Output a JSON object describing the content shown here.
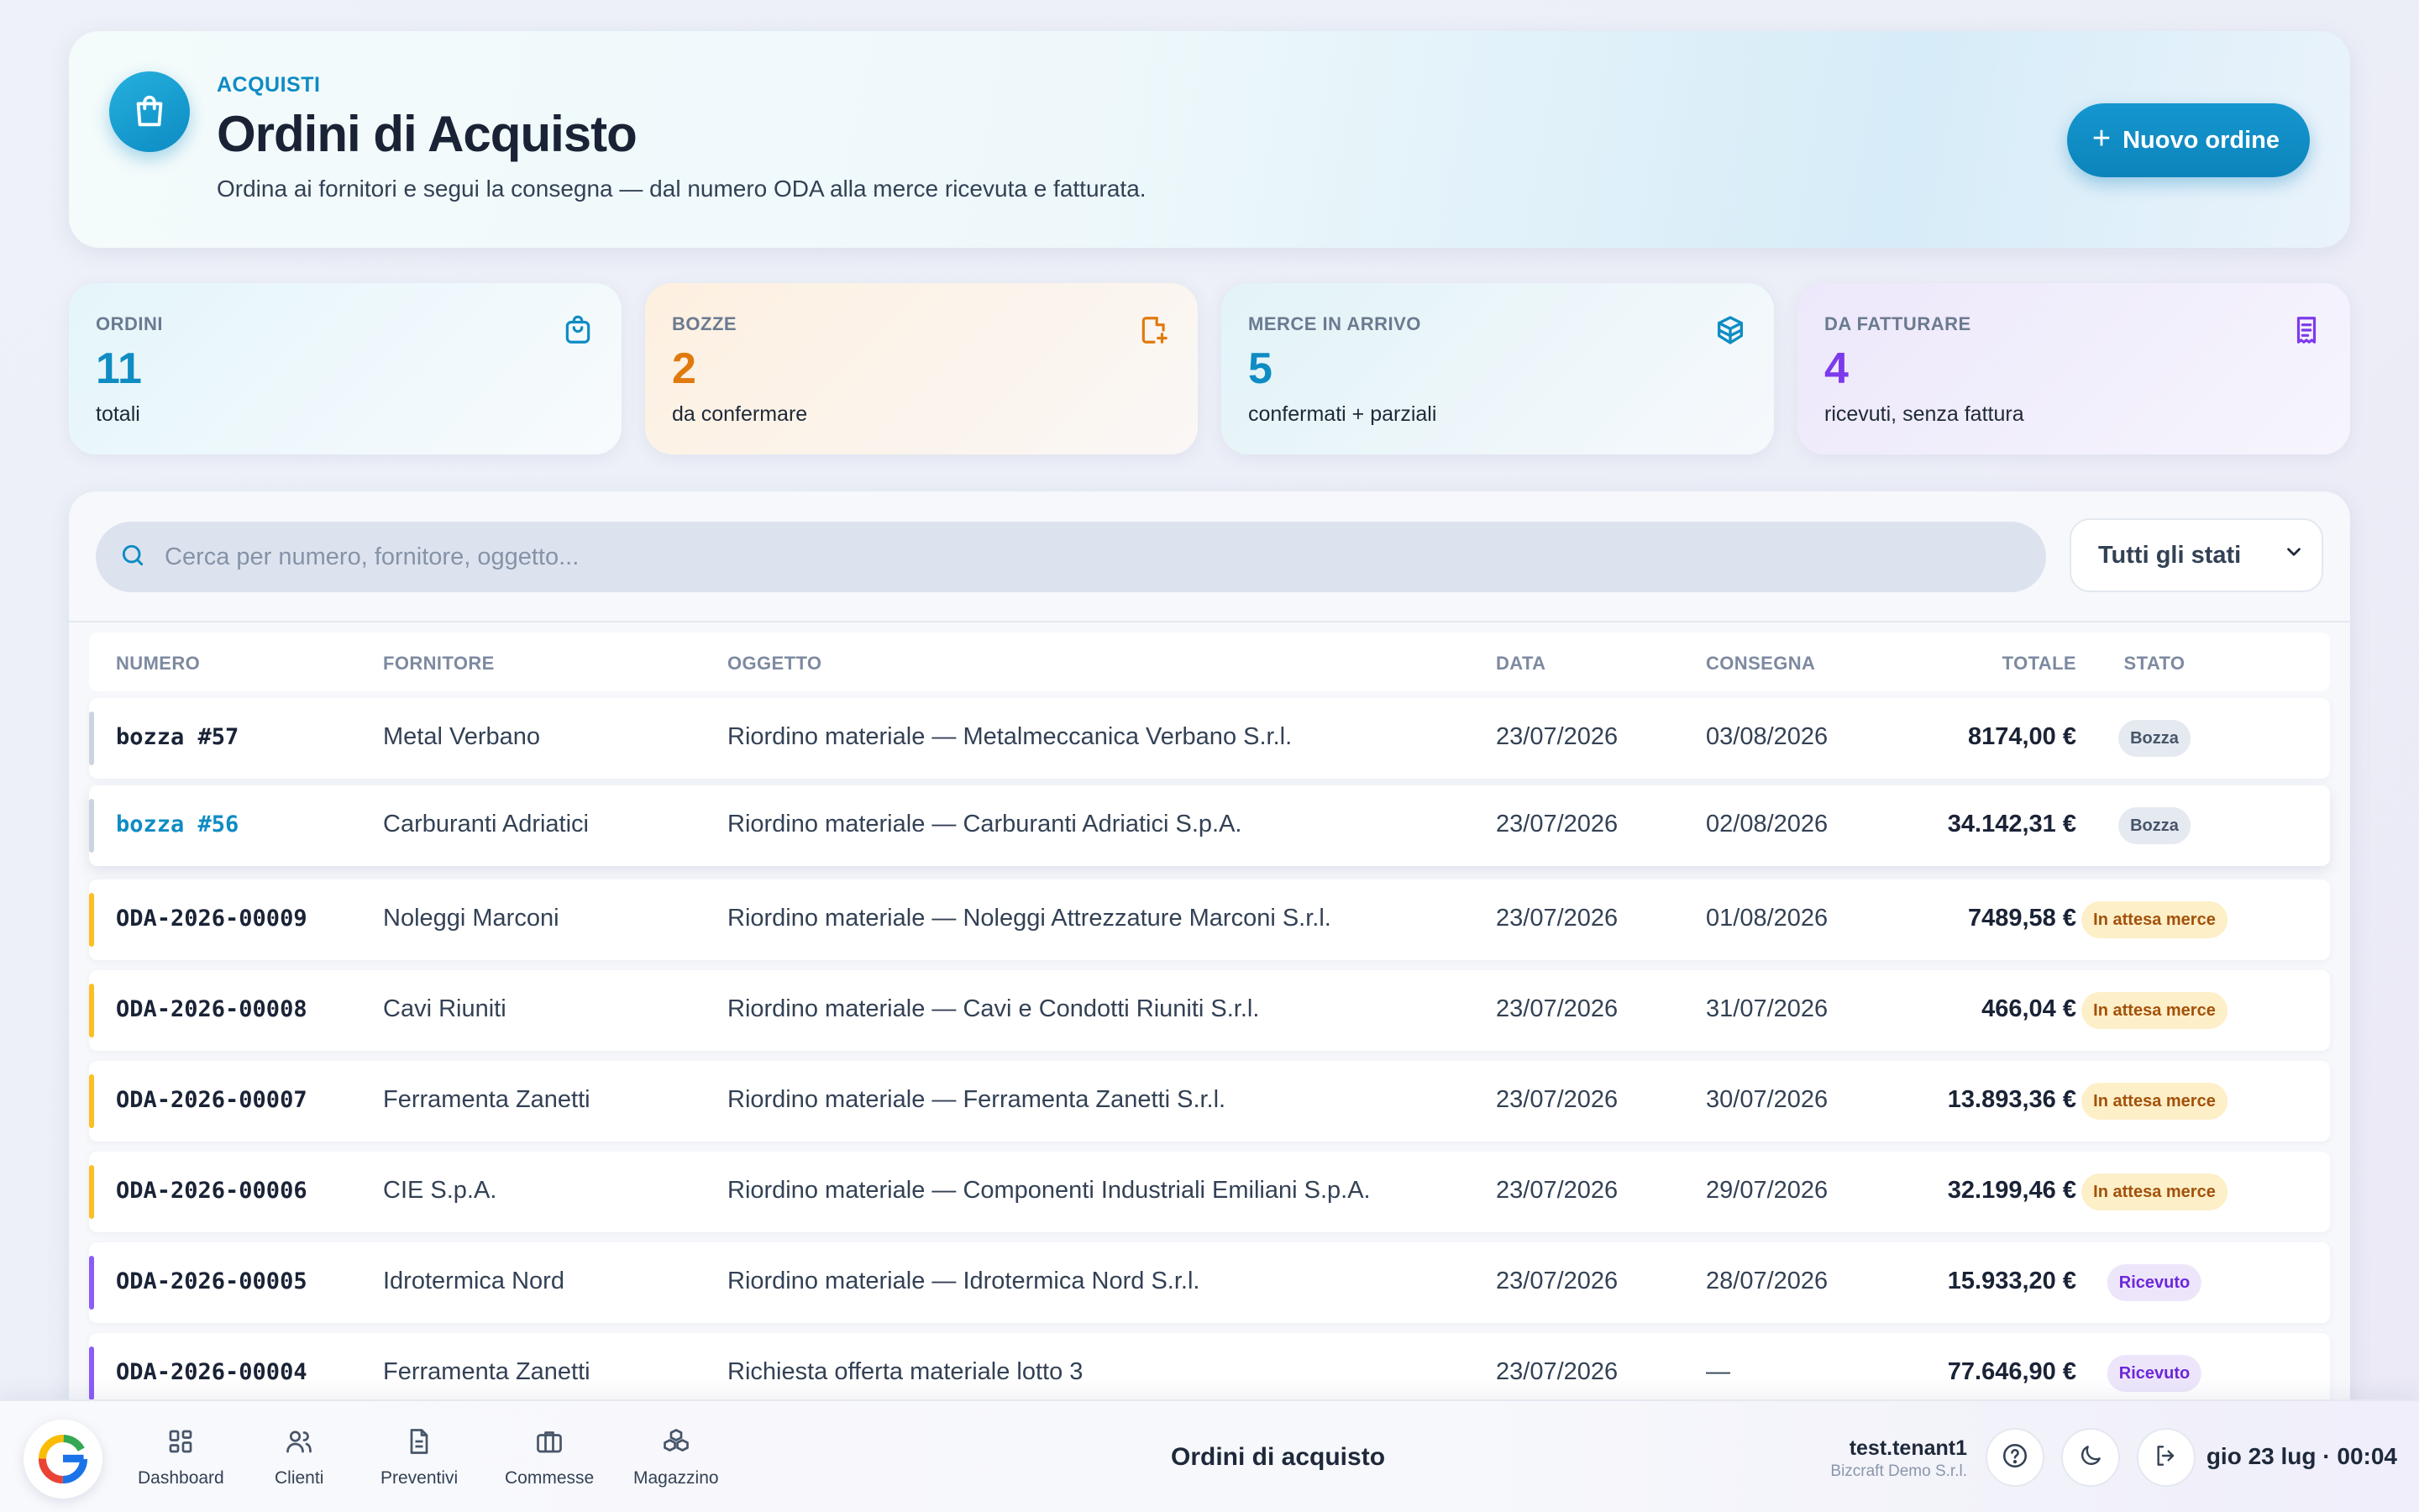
{
  "header": {
    "eyebrow": "ACQUISTI",
    "title": "Ordini di Acquisto",
    "subtitle": "Ordina ai fornitori e segui la consegna — dal numero ODA alla merce ricevuta e fatturata.",
    "new_button": "Nuovo ordine",
    "icon": "shopping-bag-icon"
  },
  "stats": [
    {
      "label": "ORDINI",
      "value": "11",
      "desc": "totali",
      "icon": "shopping-bag-icon",
      "color": "#0e8cc3"
    },
    {
      "label": "BOZZE",
      "value": "2",
      "desc": "da confermare",
      "icon": "file-plus-icon",
      "color": "#e07a0c"
    },
    {
      "label": "MERCE IN ARRIVO",
      "value": "5",
      "desc": "confermati + parziali",
      "icon": "package-icon",
      "color": "#0e8cc3"
    },
    {
      "label": "DA FATTURARE",
      "value": "4",
      "desc": "ricevuti, senza fattura",
      "icon": "receipt-icon",
      "color": "#7c3aed"
    }
  ],
  "filters": {
    "search_placeholder": "Cerca per numero, fornitore, oggetto...",
    "status_select": "Tutti gli stati"
  },
  "table": {
    "columns": [
      "NUMERO",
      "FORNITORE",
      "OGGETTO",
      "DATA",
      "CONSEGNA",
      "TOTALE",
      "STATO"
    ],
    "rows": [
      {
        "numero": "bozza #57",
        "fornitore": "Metal Verbano",
        "oggetto": "Riordino materiale — Metalmeccanica Verbano S.r.l.",
        "data": "23/07/2026",
        "consegna": "03/08/2026",
        "totale": "8174,00 €",
        "stato": "Bozza",
        "kind": "bozza"
      },
      {
        "numero": "bozza #56",
        "fornitore": "Carburanti Adriatici",
        "oggetto": "Riordino materiale — Carburanti Adriatici S.p.A.",
        "data": "23/07/2026",
        "consegna": "02/08/2026",
        "totale": "34.142,31 €",
        "stato": "Bozza",
        "kind": "bozza"
      },
      {
        "numero": "ODA-2026-00009",
        "fornitore": "Noleggi Marconi",
        "oggetto": "Riordino materiale — Noleggi Attrezzature Marconi S.r.l.",
        "data": "23/07/2026",
        "consegna": "01/08/2026",
        "totale": "7489,58 €",
        "stato": "In attesa merce",
        "kind": "attesa"
      },
      {
        "numero": "ODA-2026-00008",
        "fornitore": "Cavi Riuniti",
        "oggetto": "Riordino materiale — Cavi e Condotti Riuniti S.r.l.",
        "data": "23/07/2026",
        "consegna": "31/07/2026",
        "totale": "466,04 €",
        "stato": "In attesa merce",
        "kind": "attesa"
      },
      {
        "numero": "ODA-2026-00007",
        "fornitore": "Ferramenta Zanetti",
        "oggetto": "Riordino materiale — Ferramenta Zanetti S.r.l.",
        "data": "23/07/2026",
        "consegna": "30/07/2026",
        "totale": "13.893,36 €",
        "stato": "In attesa merce",
        "kind": "attesa"
      },
      {
        "numero": "ODA-2026-00006",
        "fornitore": "CIE S.p.A.",
        "oggetto": "Riordino materiale — Componenti Industriali Emiliani S.p.A.",
        "data": "23/07/2026",
        "consegna": "29/07/2026",
        "totale": "32.199,46 €",
        "stato": "In attesa merce",
        "kind": "attesa"
      },
      {
        "numero": "ODA-2026-00005",
        "fornitore": "Idrotermica Nord",
        "oggetto": "Riordino materiale — Idrotermica Nord S.r.l.",
        "data": "23/07/2026",
        "consegna": "28/07/2026",
        "totale": "15.933,20 €",
        "stato": "Ricevuto",
        "kind": "ricevuto"
      },
      {
        "numero": "ODA-2026-00004",
        "fornitore": "Ferramenta Zanetti",
        "oggetto": "Richiesta offerta materiale lotto 3",
        "data": "23/07/2026",
        "consegna": "—",
        "totale": "77.646,90 €",
        "stato": "Ricevuto",
        "kind": "ricevuto"
      }
    ]
  },
  "dock": {
    "nav": [
      {
        "label": "Dashboard",
        "icon": "dashboard-icon"
      },
      {
        "label": "Clienti",
        "icon": "users-icon"
      },
      {
        "label": "Preventivi",
        "icon": "document-icon"
      },
      {
        "label": "Commesse",
        "icon": "briefcase-icon"
      },
      {
        "label": "Magazzino",
        "icon": "boxes-icon"
      }
    ],
    "page_title": "Ordini di acquisto",
    "user_name": "test.tenant1",
    "company": "Bizcraft Demo S.r.l.",
    "clock": "gio 23 lug · 00:04"
  },
  "colors": {
    "accent": "#0e8cc3",
    "bozza_bar": "#cbd5e1",
    "attesa_bar": "#fbbf24",
    "ricevuto_bar": "#8b5cf6"
  }
}
